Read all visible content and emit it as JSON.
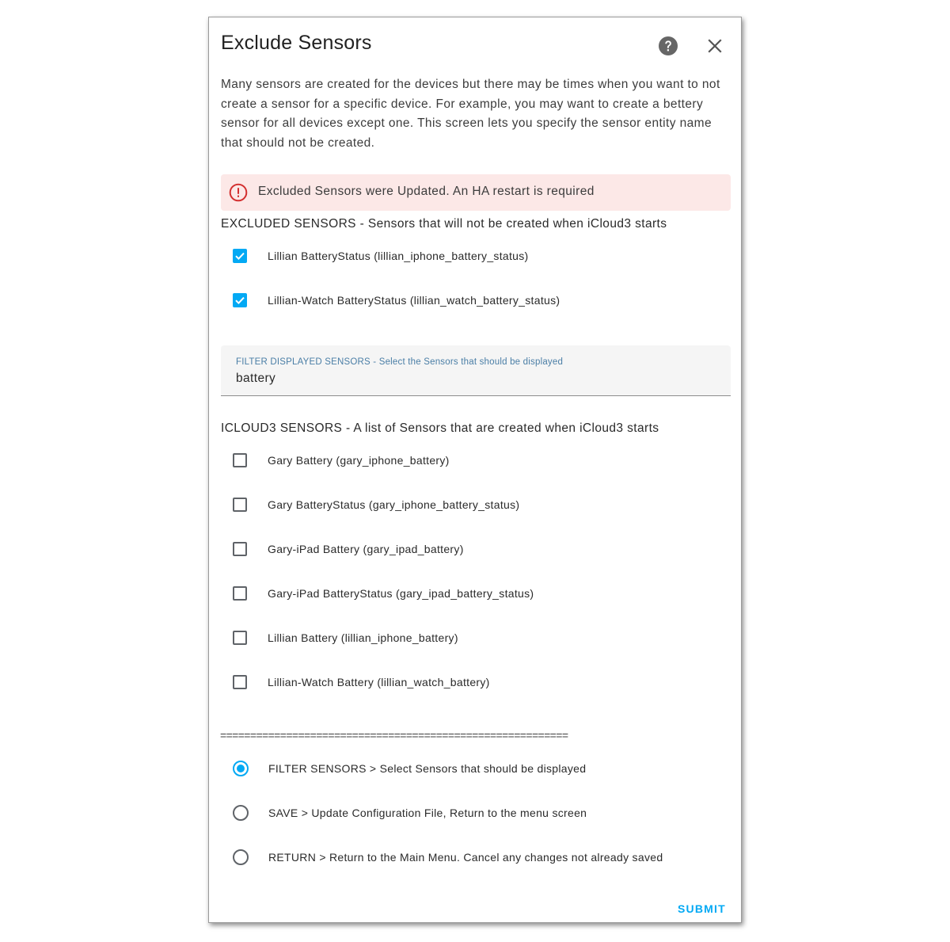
{
  "dialog": {
    "title": "Exclude Sensors",
    "description": "Many sensors are created for the devices but there may be times when you want to not create a sensor for a specific device. For example, you may want to create a bettery sensor for all devices except one. This screen lets you specify the sensor entity name that should not be created."
  },
  "alert": {
    "text": "Excluded Sensors were Updated. An HA restart is required",
    "color": "#d32f2f",
    "background": "#fce8e7"
  },
  "excluded": {
    "heading": "EXCLUDED SENSORS - Sensors that will not be created when iCloud3 starts",
    "items": [
      {
        "label": "Lillian BatteryStatus (lillian_iphone_battery_status)",
        "checked": true
      },
      {
        "label": "Lillian-Watch BatteryStatus (lillian_watch_battery_status)",
        "checked": true
      }
    ]
  },
  "filter": {
    "label": "FILTER DISPLAYED SENSORS - Select the Sensors that should be displayed",
    "value": "battery"
  },
  "icloud3": {
    "heading": "ICLOUD3 SENSORS - A list of Sensors that are created when iCloud3 starts",
    "items": [
      {
        "label": "Gary Battery (gary_iphone_battery)",
        "checked": false
      },
      {
        "label": "Gary BatteryStatus (gary_iphone_battery_status)",
        "checked": false
      },
      {
        "label": "Gary-iPad Battery (gary_ipad_battery)",
        "checked": false
      },
      {
        "label": "Gary-iPad BatteryStatus (gary_ipad_battery_status)",
        "checked": false
      },
      {
        "label": "Lillian Battery (lillian_iphone_battery)",
        "checked": false
      },
      {
        "label": "Lillian-Watch Battery (lillian_watch_battery)",
        "checked": false
      }
    ]
  },
  "divider": "==========================================================",
  "actions": {
    "options": [
      {
        "label": "FILTER SENSORS > Select Sensors that should be displayed",
        "selected": true
      },
      {
        "label": "SAVE > Update Configuration File, Return to the menu screen",
        "selected": false
      },
      {
        "label": "RETURN > Return to the Main Menu. Cancel any changes not already saved",
        "selected": false
      }
    ],
    "submit_label": "SUBMIT"
  },
  "colors": {
    "accent": "#03a9f4",
    "filter_label": "#4a7ea6",
    "icon_gray": "#666666"
  }
}
